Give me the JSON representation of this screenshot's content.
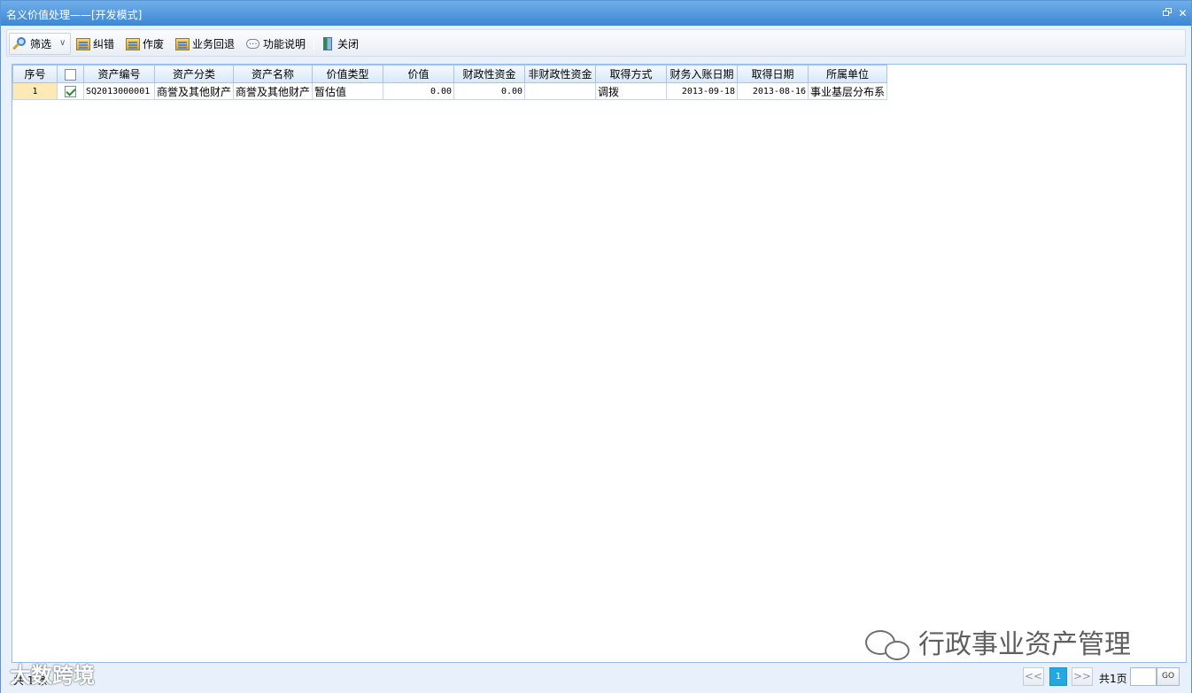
{
  "window": {
    "title": "名义价值处理——[开发模式]",
    "restore_icon": "restore-window-icon",
    "close_label": "✕"
  },
  "toolbar": {
    "filter_label": "筛选",
    "filter_caret": "∨",
    "correct_label": "纠错",
    "void_label": "作废",
    "rollback_label": "业务回退",
    "help_label": "功能说明",
    "close_label": "关闭"
  },
  "grid": {
    "columns": [
      "序号",
      "",
      "资产编号",
      "资产分类",
      "资产名称",
      "价值类型",
      "价值",
      "财政性资金",
      "非财政性资金",
      "取得方式",
      "财务入账日期",
      "取得日期",
      "所属单位"
    ],
    "rows": [
      {
        "index": "1",
        "checked": true,
        "asset_code": "SQ2013000001",
        "asset_category": "商誉及其他财产",
        "asset_name": "商誉及其他财产",
        "value_type": "暂估值",
        "value": "0.00",
        "fiscal_funds": "0.00",
        "non_fiscal_funds": "",
        "acquire_method": "调拨",
        "finance_entry_date": "2013-09-18",
        "acquire_date": "2013-08-16",
        "unit": "事业基层分布系"
      }
    ]
  },
  "status": {
    "total_text": "共 1 条",
    "prev_label": "<<",
    "current_page": "1",
    "next_label": ">>",
    "pages_text": "共1页",
    "page_input": "",
    "go_label": "GO"
  },
  "watermark": {
    "text": "行政事业资产管理",
    "corner_text": "大数跨境"
  }
}
